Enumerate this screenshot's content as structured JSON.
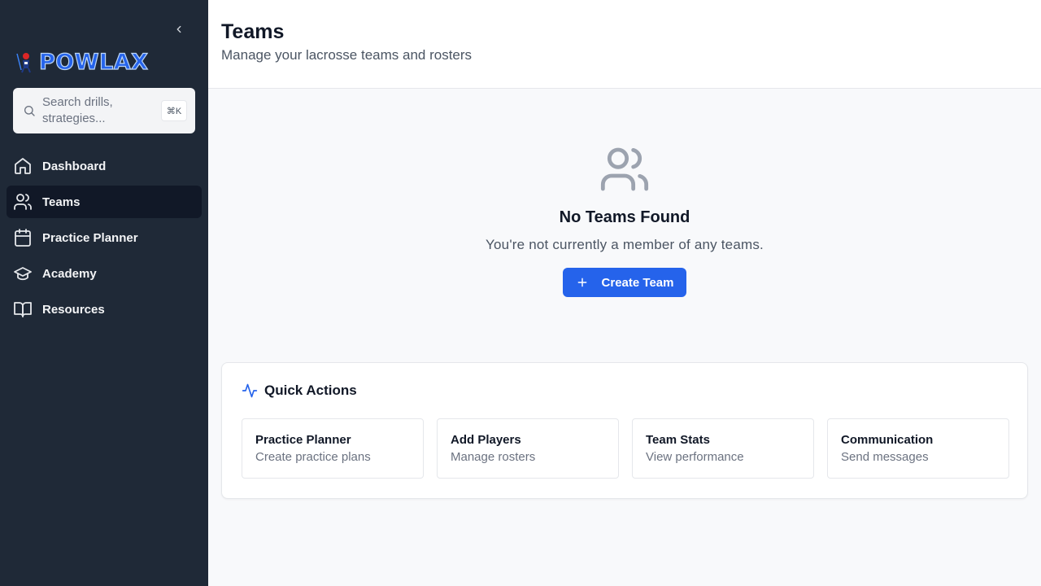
{
  "sidebar": {
    "brand": "POWLAX",
    "search": {
      "placeholder": "Search drills, strategies...",
      "shortcut": "⌘K"
    },
    "items": [
      {
        "label": "Dashboard",
        "icon": "home-icon",
        "active": false
      },
      {
        "label": "Teams",
        "icon": "users-icon",
        "active": true
      },
      {
        "label": "Practice Planner",
        "icon": "calendar-icon",
        "active": false
      },
      {
        "label": "Academy",
        "icon": "graduation-cap-icon",
        "active": false
      },
      {
        "label": "Resources",
        "icon": "book-open-icon",
        "active": false
      }
    ]
  },
  "header": {
    "title": "Teams",
    "subtitle": "Manage your lacrosse teams and rosters"
  },
  "empty_state": {
    "icon": "users-icon",
    "title": "No Teams Found",
    "description": "You're not currently a member of any teams.",
    "button_label": "Create Team"
  },
  "quick_actions": {
    "title": "Quick Actions",
    "icon": "activity-icon",
    "items": [
      {
        "title": "Practice Planner",
        "subtitle": "Create practice plans"
      },
      {
        "title": "Add Players",
        "subtitle": "Manage rosters"
      },
      {
        "title": "Team Stats",
        "subtitle": "View performance"
      },
      {
        "title": "Communication",
        "subtitle": "Send messages"
      }
    ]
  },
  "colors": {
    "sidebar_bg": "#1f2937",
    "active_nav_bg": "#111827",
    "accent": "#2563eb",
    "page_bg": "#f8f9fb"
  }
}
